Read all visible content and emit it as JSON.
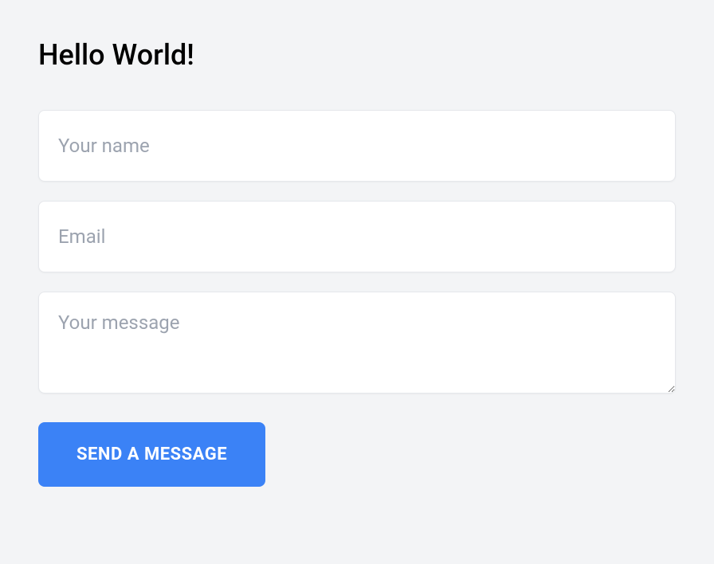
{
  "title": "Hello World!",
  "form": {
    "name_placeholder": "Your name",
    "email_placeholder": "Email",
    "message_placeholder": "Your message",
    "submit_label": "Send a message"
  }
}
